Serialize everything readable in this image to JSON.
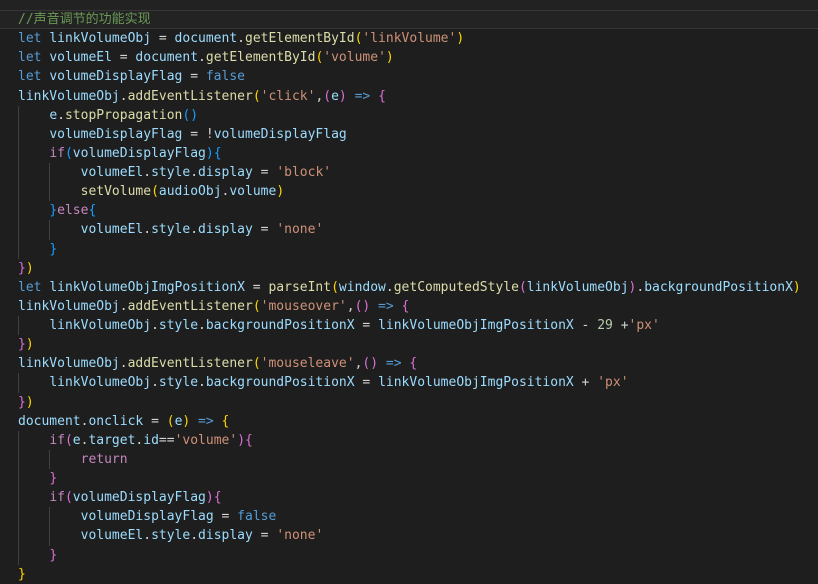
{
  "editor": {
    "colors": {
      "background": "#1e1e1e",
      "top_strip": "#222222",
      "current_line_bg": "#232323",
      "current_line_border": "#373737",
      "indent_guide": "#404040"
    },
    "token_colors": {
      "comment": "#6A9955",
      "keyword": "#569CD6",
      "control": "#C586C0",
      "variable": "#9CDCFE",
      "function": "#DCDCAA",
      "string": "#CE9178",
      "number": "#B5CEA8",
      "punct": "#D4D4D4",
      "b1": "#FFD700",
      "b2": "#DA70D6",
      "b3": "#179FFF"
    },
    "lines": [
      {
        "current": true,
        "tokens": [
          [
            "comment",
            "//声音调节的功能实现"
          ]
        ]
      },
      {
        "tokens": [
          [
            "keyword",
            "let "
          ],
          [
            "variable",
            "linkVolumeObj"
          ],
          [
            "punct",
            " = "
          ],
          [
            "variable",
            "document"
          ],
          [
            "punct",
            "."
          ],
          [
            "function",
            "getElementById"
          ],
          [
            "b1",
            "("
          ],
          [
            "string",
            "'linkVolume'"
          ],
          [
            "b1",
            ")"
          ]
        ]
      },
      {
        "tokens": [
          [
            "keyword",
            "let "
          ],
          [
            "variable",
            "volumeEl"
          ],
          [
            "punct",
            " = "
          ],
          [
            "variable",
            "document"
          ],
          [
            "punct",
            "."
          ],
          [
            "function",
            "getElementById"
          ],
          [
            "b1",
            "("
          ],
          [
            "string",
            "'volume'"
          ],
          [
            "b1",
            ")"
          ]
        ]
      },
      {
        "tokens": [
          [
            "keyword",
            "let "
          ],
          [
            "variable",
            "volumeDisplayFlag"
          ],
          [
            "punct",
            " = "
          ],
          [
            "keyword",
            "false"
          ]
        ]
      },
      {
        "tokens": [
          [
            "variable",
            "linkVolumeObj"
          ],
          [
            "punct",
            "."
          ],
          [
            "function",
            "addEventListener"
          ],
          [
            "b1",
            "("
          ],
          [
            "string",
            "'click'"
          ],
          [
            "punct",
            ","
          ],
          [
            "b2",
            "("
          ],
          [
            "variable",
            "e"
          ],
          [
            "b2",
            ")"
          ],
          [
            "punct",
            " "
          ],
          [
            "keyword",
            "=>"
          ],
          [
            "punct",
            " "
          ],
          [
            "b2",
            "{"
          ]
        ]
      },
      {
        "tokens": [
          [
            "punct",
            "    "
          ],
          [
            "variable",
            "e"
          ],
          [
            "punct",
            "."
          ],
          [
            "function",
            "stopPropagation"
          ],
          [
            "b3",
            "()"
          ]
        ]
      },
      {
        "tokens": [
          [
            "punct",
            "    "
          ],
          [
            "variable",
            "volumeDisplayFlag"
          ],
          [
            "punct",
            " = !"
          ],
          [
            "variable",
            "volumeDisplayFlag"
          ]
        ]
      },
      {
        "tokens": [
          [
            "punct",
            "    "
          ],
          [
            "control",
            "if"
          ],
          [
            "b3",
            "("
          ],
          [
            "variable",
            "volumeDisplayFlag"
          ],
          [
            "b3",
            ")"
          ],
          [
            "b3",
            "{"
          ]
        ]
      },
      {
        "tokens": [
          [
            "punct",
            "        "
          ],
          [
            "variable",
            "volumeEl"
          ],
          [
            "punct",
            "."
          ],
          [
            "variable",
            "style"
          ],
          [
            "punct",
            "."
          ],
          [
            "variable",
            "display"
          ],
          [
            "punct",
            " = "
          ],
          [
            "string",
            "'block'"
          ]
        ]
      },
      {
        "tokens": [
          [
            "punct",
            "        "
          ],
          [
            "function",
            "setVolume"
          ],
          [
            "b1",
            "("
          ],
          [
            "variable",
            "audioObj"
          ],
          [
            "punct",
            "."
          ],
          [
            "variable",
            "volume"
          ],
          [
            "b1",
            ")"
          ]
        ]
      },
      {
        "tokens": [
          [
            "punct",
            "    "
          ],
          [
            "b3",
            "}"
          ],
          [
            "control",
            "else"
          ],
          [
            "b3",
            "{"
          ]
        ]
      },
      {
        "tokens": [
          [
            "punct",
            "        "
          ],
          [
            "variable",
            "volumeEl"
          ],
          [
            "punct",
            "."
          ],
          [
            "variable",
            "style"
          ],
          [
            "punct",
            "."
          ],
          [
            "variable",
            "display"
          ],
          [
            "punct",
            " = "
          ],
          [
            "string",
            "'none'"
          ]
        ]
      },
      {
        "tokens": [
          [
            "punct",
            "    "
          ],
          [
            "b3",
            "}"
          ]
        ]
      },
      {
        "tokens": [
          [
            "b2",
            "}"
          ],
          [
            "b1",
            ")"
          ]
        ]
      },
      {
        "tokens": [
          [
            "keyword",
            "let "
          ],
          [
            "variable",
            "linkVolumeObjImgPositionX"
          ],
          [
            "punct",
            " = "
          ],
          [
            "function",
            "parseInt"
          ],
          [
            "b1",
            "("
          ],
          [
            "variable",
            "window"
          ],
          [
            "punct",
            "."
          ],
          [
            "function",
            "getComputedStyle"
          ],
          [
            "b2",
            "("
          ],
          [
            "variable",
            "linkVolumeObj"
          ],
          [
            "b2",
            ")"
          ],
          [
            "punct",
            "."
          ],
          [
            "variable",
            "backgroundPositionX"
          ],
          [
            "b1",
            ")"
          ]
        ]
      },
      {
        "tokens": [
          [
            "variable",
            "linkVolumeObj"
          ],
          [
            "punct",
            "."
          ],
          [
            "function",
            "addEventListener"
          ],
          [
            "b1",
            "("
          ],
          [
            "string",
            "'mouseover'"
          ],
          [
            "punct",
            ","
          ],
          [
            "b2",
            "()"
          ],
          [
            "punct",
            " "
          ],
          [
            "keyword",
            "=>"
          ],
          [
            "punct",
            " "
          ],
          [
            "b2",
            "{"
          ]
        ]
      },
      {
        "tokens": [
          [
            "punct",
            "    "
          ],
          [
            "variable",
            "linkVolumeObj"
          ],
          [
            "punct",
            "."
          ],
          [
            "variable",
            "style"
          ],
          [
            "punct",
            "."
          ],
          [
            "variable",
            "backgroundPositionX"
          ],
          [
            "punct",
            " = "
          ],
          [
            "variable",
            "linkVolumeObjImgPositionX"
          ],
          [
            "punct",
            " - "
          ],
          [
            "number",
            "29"
          ],
          [
            "punct",
            " +"
          ],
          [
            "string",
            "'px'"
          ]
        ]
      },
      {
        "tokens": [
          [
            "b2",
            "}"
          ],
          [
            "b1",
            ")"
          ]
        ]
      },
      {
        "tokens": [
          [
            "variable",
            "linkVolumeObj"
          ],
          [
            "punct",
            "."
          ],
          [
            "function",
            "addEventListener"
          ],
          [
            "b1",
            "("
          ],
          [
            "string",
            "'mouseleave'"
          ],
          [
            "punct",
            ","
          ],
          [
            "b2",
            "()"
          ],
          [
            "punct",
            " "
          ],
          [
            "keyword",
            "=>"
          ],
          [
            "punct",
            " "
          ],
          [
            "b2",
            "{"
          ]
        ]
      },
      {
        "tokens": [
          [
            "punct",
            "    "
          ],
          [
            "variable",
            "linkVolumeObj"
          ],
          [
            "punct",
            "."
          ],
          [
            "variable",
            "style"
          ],
          [
            "punct",
            "."
          ],
          [
            "variable",
            "backgroundPositionX"
          ],
          [
            "punct",
            " = "
          ],
          [
            "variable",
            "linkVolumeObjImgPositionX"
          ],
          [
            "punct",
            " + "
          ],
          [
            "string",
            "'px'"
          ]
        ]
      },
      {
        "tokens": [
          [
            "b2",
            "}"
          ],
          [
            "b1",
            ")"
          ]
        ]
      },
      {
        "tokens": [
          [
            "variable",
            "document"
          ],
          [
            "punct",
            "."
          ],
          [
            "variable",
            "onclick"
          ],
          [
            "punct",
            " = "
          ],
          [
            "b1",
            "("
          ],
          [
            "variable",
            "e"
          ],
          [
            "b1",
            ")"
          ],
          [
            "punct",
            " "
          ],
          [
            "keyword",
            "=>"
          ],
          [
            "punct",
            " "
          ],
          [
            "b1",
            "{"
          ]
        ]
      },
      {
        "tokens": [
          [
            "punct",
            "    "
          ],
          [
            "control",
            "if"
          ],
          [
            "b2",
            "("
          ],
          [
            "variable",
            "e"
          ],
          [
            "punct",
            "."
          ],
          [
            "variable",
            "target"
          ],
          [
            "punct",
            "."
          ],
          [
            "variable",
            "id"
          ],
          [
            "punct",
            "=="
          ],
          [
            "string",
            "'volume'"
          ],
          [
            "b2",
            ")"
          ],
          [
            "b2",
            "{"
          ]
        ]
      },
      {
        "tokens": [
          [
            "punct",
            "        "
          ],
          [
            "control",
            "return"
          ]
        ]
      },
      {
        "tokens": [
          [
            "punct",
            "    "
          ],
          [
            "b2",
            "}"
          ]
        ]
      },
      {
        "tokens": [
          [
            "punct",
            "    "
          ],
          [
            "control",
            "if"
          ],
          [
            "b2",
            "("
          ],
          [
            "variable",
            "volumeDisplayFlag"
          ],
          [
            "b2",
            ")"
          ],
          [
            "b2",
            "{"
          ]
        ]
      },
      {
        "tokens": [
          [
            "punct",
            "        "
          ],
          [
            "variable",
            "volumeDisplayFlag"
          ],
          [
            "punct",
            " = "
          ],
          [
            "keyword",
            "false"
          ]
        ]
      },
      {
        "tokens": [
          [
            "punct",
            "        "
          ],
          [
            "variable",
            "volumeEl"
          ],
          [
            "punct",
            "."
          ],
          [
            "variable",
            "style"
          ],
          [
            "punct",
            "."
          ],
          [
            "variable",
            "display"
          ],
          [
            "punct",
            " = "
          ],
          [
            "string",
            "'none'"
          ]
        ]
      },
      {
        "tokens": [
          [
            "punct",
            "    "
          ],
          [
            "b2",
            "}"
          ]
        ]
      },
      {
        "tokens": [
          [
            "b1",
            "}"
          ]
        ]
      }
    ]
  }
}
